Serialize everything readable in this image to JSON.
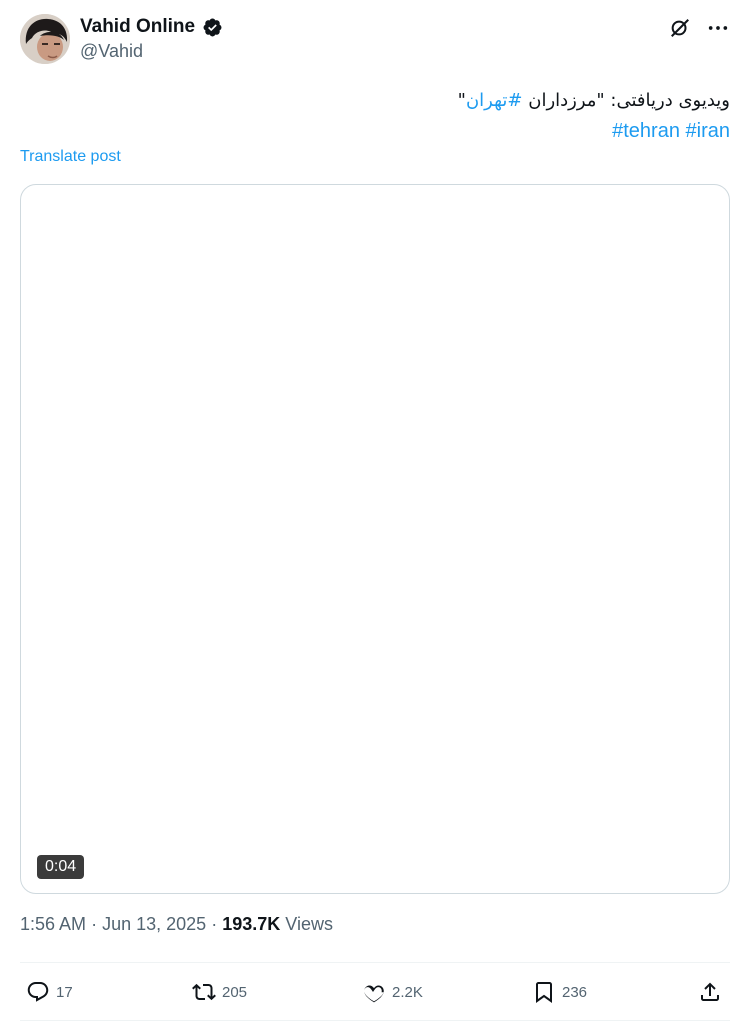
{
  "author": {
    "display_name": "Vahid Online",
    "handle": "@Vahid"
  },
  "tweet": {
    "rtl_text_prefix": "ویدیوی دریافتی: \"مرزداران ",
    "rtl_hashtag": "#تهران",
    "rtl_text_suffix": "\"",
    "hashtags": [
      "#tehran",
      "#iran"
    ],
    "translate_label": "Translate post"
  },
  "media": {
    "duration": "0:04"
  },
  "meta": {
    "time": "1:56 AM",
    "date": "Jun 13, 2025",
    "separator": "·",
    "views_count": "193.7K",
    "views_label": "Views"
  },
  "actions": {
    "replies": "17",
    "reposts": "205",
    "likes": "2.2K",
    "bookmarks": "236"
  },
  "colors": {
    "accent": "#1d9bf0",
    "secondary_text": "#536471",
    "border": "#cfd9de"
  }
}
